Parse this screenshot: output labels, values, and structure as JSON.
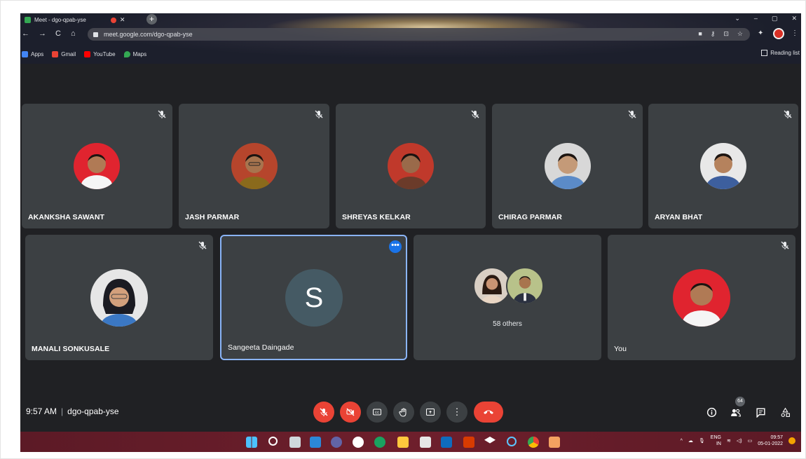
{
  "browser": {
    "tab_title": "Meet - dgo-qpab-yse",
    "tab_close": "✕",
    "new_tab": "+",
    "url": "meet.google.com/dgo-qpab-yse",
    "bookmarks": [
      {
        "label": "Apps",
        "color": "#4285f4"
      },
      {
        "label": "Gmail",
        "color": "#ea4335"
      },
      {
        "label": "YouTube",
        "color": "#ff0000"
      },
      {
        "label": "Maps",
        "color": "#34a853"
      }
    ],
    "reading_list": "Reading list"
  },
  "participants": [
    {
      "name": "AKANKSHA SAWANT",
      "muted": true,
      "avatar_bg": "#e0242f"
    },
    {
      "name": "JASH PARMAR",
      "muted": true,
      "avatar_bg": "#b6452c"
    },
    {
      "name": "SHREYAS KELKAR",
      "muted": true,
      "avatar_bg": "#c0392b"
    },
    {
      "name": "CHIRAG PARMAR",
      "muted": true,
      "avatar_bg": "#d8d8d8"
    },
    {
      "name": "ARYAN BHAT",
      "muted": true,
      "avatar_bg": "#e8e8e8"
    },
    {
      "name": "MANALI SONKUSALE",
      "muted": true,
      "avatar_bg": "#e6e6e6"
    },
    {
      "name": "Sangeeta Daingade",
      "initial": "S",
      "active_speaker": true
    },
    {
      "others_label": "58 others"
    },
    {
      "name": "You",
      "muted": true,
      "avatar_bg": "#e0242f"
    }
  ],
  "meeting": {
    "time": "9:57 AM",
    "separator": "|",
    "code": "dgo-qpab-yse"
  },
  "controls": {
    "more_label": "⋮",
    "participants_count": "64"
  },
  "taskbar": {
    "lang_top": "ENG",
    "lang_bottom": "IN",
    "time": "09:57",
    "date": "05-01-2022"
  },
  "colors": {
    "meet_bg": "#202124",
    "tile_bg": "#3c4043",
    "end_call": "#ea4335",
    "active_border": "#8ab4f8"
  }
}
